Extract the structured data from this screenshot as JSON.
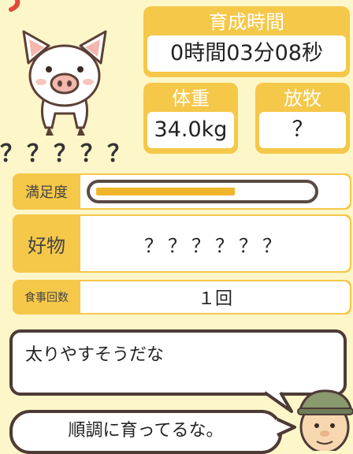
{
  "stats": {
    "time_label": "育成時間",
    "time_value": "0時間03分08秒",
    "weight_label": "体重",
    "weight_value": "34.0kg",
    "grazing_label": "放牧",
    "grazing_value": "？"
  },
  "pig": {
    "name": "？？？？？"
  },
  "satisfaction": {
    "label": "満足度",
    "level": 0.65
  },
  "favorite": {
    "label": "好物",
    "value": "？？？？？？"
  },
  "meals": {
    "label": "食事回数",
    "value": "１回"
  },
  "dialogue": {
    "pig_speech": "太りやすそうだな",
    "farmer_speech": "順調に育ってるな。"
  },
  "colors": {
    "card_yellow": "#f5c84a",
    "background": "#fdf6c8",
    "gauge_fill": "#f0b62b",
    "outline_brown": "#4d3b36"
  }
}
